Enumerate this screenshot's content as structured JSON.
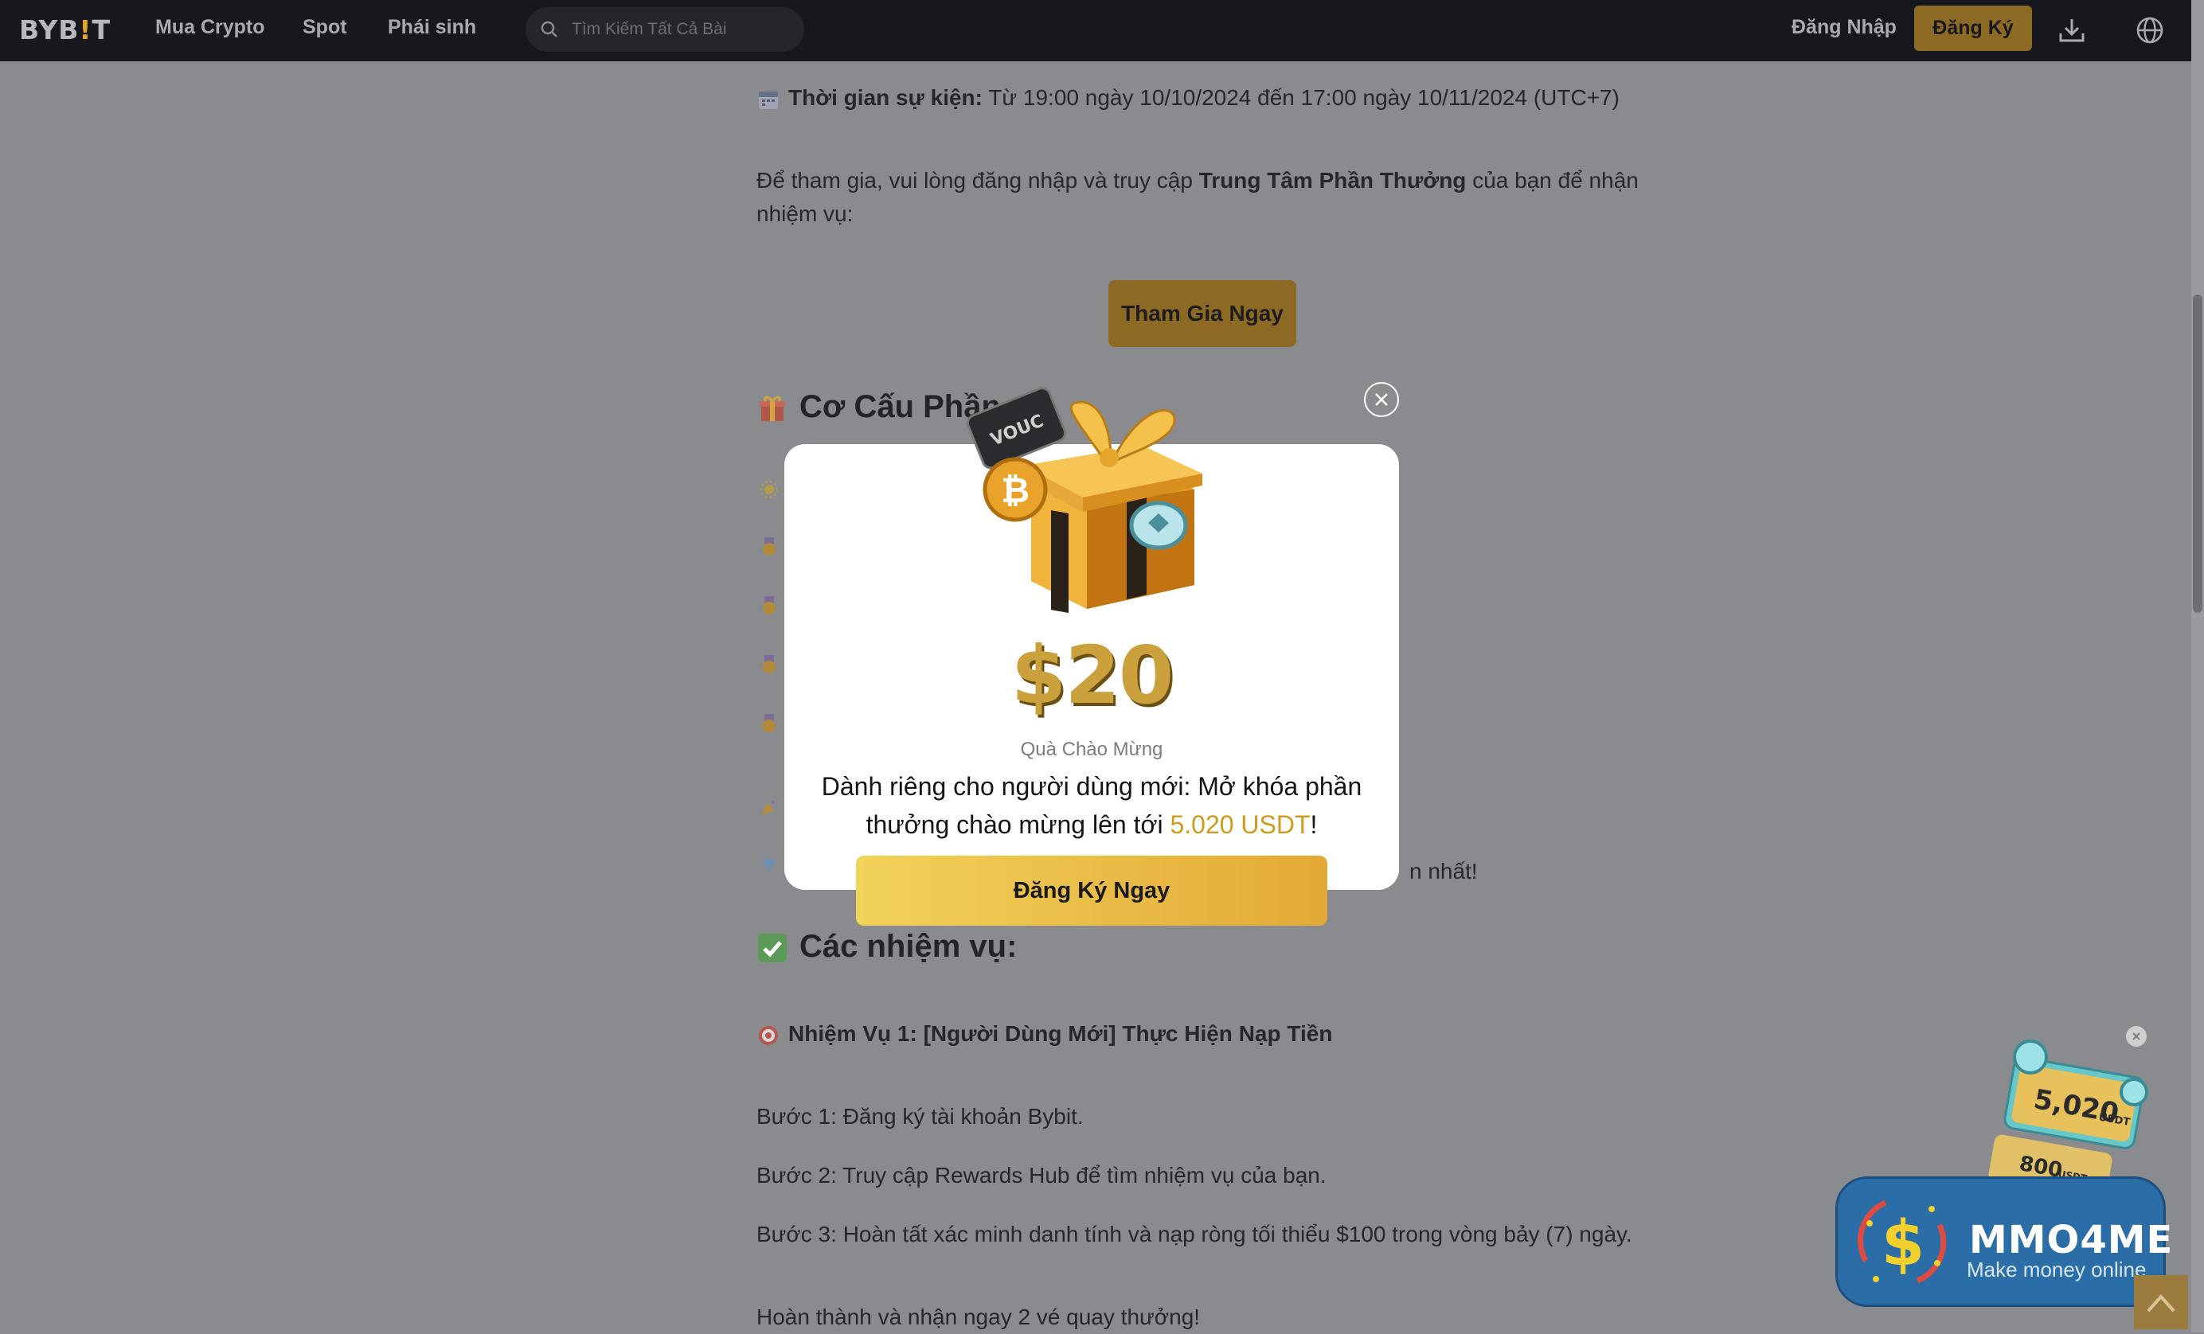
{
  "nav": {
    "logo_text": "BYB",
    "logo_tail": "T",
    "links": [
      "Mua Crypto",
      "Spot",
      "Phái sinh"
    ],
    "search_placeholder": "Tìm Kiếm Tất Cả Bài",
    "login": "Đăng Nhập",
    "signup": "Đăng Ký"
  },
  "article": {
    "event_time_label": "Thời gian sự kiện:",
    "event_time_value": " Từ 19:00 ngày 10/10/2024 đến 17:00 ngày 10/11/2024 (UTC+7)",
    "intro_part1": "Để tham gia, vui lòng đăng nhập và truy cập ",
    "intro_bold": "Trung Tâm Phần Thưởng",
    "intro_part2": " của bạn để nhận",
    "intro_line2": "nhiệm vụ:",
    "join_button": "Tham Gia Ngay",
    "section_rewards": "Cơ Cấu Phần",
    "partial_text": "n nhất!",
    "section_tasks": "Các nhiệm vụ:",
    "task1_title": "Nhiệm Vụ 1: [Người Dùng Mới] Thực Hiện Nạp Tiền",
    "step1": "Bước 1: Đăng ký tài khoản Bybit.",
    "step2": "Bước 2: Truy cập Rewards Hub để tìm nhiệm vụ của bạn.",
    "step3": "Bước 3: Hoàn tất xác minh danh tính và nạp ròng tối thiểu $100 trong vòng bảy (7) ngày.",
    "finish": "Hoàn thành và nhận ngay 2 vé quay thưởng!"
  },
  "modal": {
    "amount": "$20",
    "label": "Quà Chào Mừng",
    "headline_part1": "Dành riêng cho người dùng mới: Mở khóa phần thưởng chào mừng lên tới ",
    "headline_highlight": "5.020 USDT",
    "headline_part2": "!",
    "cta": "Đăng Ký Ngay",
    "gift_voucher_text": "VOUC"
  },
  "promo": {
    "ticket1": "5,020",
    "ticket1_unit": "USDT",
    "ticket2": "800",
    "ticket2_unit": "USDT"
  },
  "watermark": {
    "title": "MMO4ME",
    "subtitle": "Make money online"
  },
  "colors": {
    "nav_bg": "#17181e",
    "overlay_bg": "#8a8b8e",
    "brand_gold": "#e0a526",
    "cta_gold": "#e3a935",
    "highlight": "#d09b1d"
  }
}
